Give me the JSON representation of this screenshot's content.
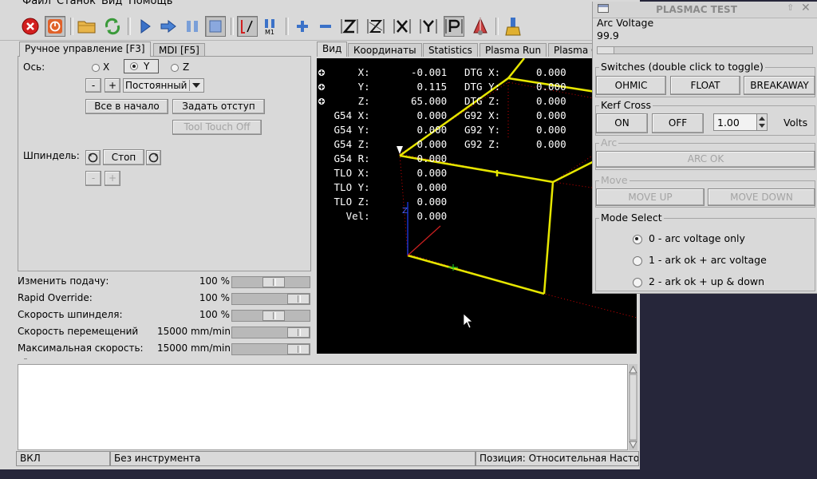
{
  "menu": {
    "items": [
      "Файл",
      "Станок",
      "Вид",
      "Помощь"
    ]
  },
  "toolbar": {
    "icons": [
      "estop-icon",
      "power-icon",
      "open-file-icon",
      "reload-icon",
      "run-icon",
      "step-icon",
      "pause-icon",
      "stop-icon",
      "block-delete-icon",
      "optional-stop-icon",
      "zoom-in-icon",
      "zoom-out-icon",
      "view-z-icon",
      "view-z2-icon",
      "view-x-icon",
      "view-y-icon",
      "view-p-icon",
      "rotate-view-icon",
      "clear-plot-icon"
    ]
  },
  "tabs_left": {
    "manual": "Ручное управление [F3]",
    "mdi": "MDI [F5]"
  },
  "manual": {
    "axis_label": "Ось:",
    "axes": [
      "X",
      "Y",
      "Z"
    ],
    "selected_axis": "Y",
    "jog_minus": "-",
    "jog_plus": "+",
    "jog_mode": "Постоянный",
    "home_all": "Все в начало",
    "touch_off": "Задать отступ",
    "tool_touch_off": "Tool Touch Off",
    "spindle_label": "Шпиндель:",
    "spindle_stop": "Стоп",
    "spindle_minus": "-",
    "spindle_plus": "+"
  },
  "overrides": [
    {
      "label": "Изменить подачу:",
      "value": "100 %",
      "fraction": 0.55
    },
    {
      "label": "Rapid Override:",
      "value": "100 %",
      "fraction": 1.0
    },
    {
      "label": "Скорость шпинделя:",
      "value": "100 %",
      "fraction": 0.55
    },
    {
      "label": "Скорость перемещений",
      "value": "15000 mm/min",
      "fraction": 1.0
    },
    {
      "label": "Максимальная скорость:",
      "value": "15000 mm/min",
      "fraction": 1.0
    }
  ],
  "tabs_right": [
    "Вид",
    "Координаты",
    "Statistics",
    "Plasma Run",
    "Plasma C"
  ],
  "dro": {
    "rows": [
      {
        "label": "     X:",
        "value": "-0.001",
        "label2": "DTG X:",
        "value2": "0.000"
      },
      {
        "label": "     Y:",
        "value": " 0.115",
        "label2": "DTG Y:",
        "value2": "0.000"
      },
      {
        "label": "     Z:",
        "value": "65.000",
        "label2": "DTG Z:",
        "value2": "0.000"
      },
      {
        "label": " G54 X:",
        "value": " 0.000",
        "label2": "G92 X:",
        "value2": "0.000"
      },
      {
        "label": " G54 Y:",
        "value": " 0.000",
        "label2": "G92 Y:",
        "value2": "0.000"
      },
      {
        "label": " G54 Z:",
        "value": " 0.000",
        "label2": "G92 Z:",
        "value2": "0.000"
      },
      {
        "label": " G54 R:",
        "value": " 0.000",
        "label2": "",
        "value2": ""
      },
      {
        "label": " TLO X:",
        "value": " 0.000",
        "label2": "",
        "value2": ""
      },
      {
        "label": " TLO Y:",
        "value": " 0.000",
        "label2": "",
        "value2": ""
      },
      {
        "label": " TLO Z:",
        "value": " 0.000",
        "label2": "",
        "value2": ""
      },
      {
        "label": "   Vel:",
        "value": " 0.000",
        "label2": "",
        "value2": ""
      }
    ]
  },
  "status": {
    "machine": "ВКЛ",
    "tool": "Без инструмента",
    "position": "Позиция: Относительная Настоящая"
  },
  "plasmac": {
    "title": "PLASMAC TEST",
    "arc_voltage_label": "Arc Voltage",
    "arc_voltage_value": "99.9",
    "switches_label": "Switches (double click to toggle)",
    "switches": [
      "OHMIC",
      "FLOAT",
      "BREAKAWAY"
    ],
    "kerf_label": "Kerf Cross",
    "kerf_on": "ON",
    "kerf_off": "OFF",
    "kerf_value": "1.00",
    "volts_label": "Volts",
    "arc_label": "Arc",
    "arc_ok": "ARC OK",
    "move_label": "Move",
    "move_up": "MOVE UP",
    "move_down": "MOVE DOWN",
    "mode_label": "Mode Select",
    "modes": [
      "0 - arc voltage only",
      "1 - ark ok + arc voltage",
      "2 - ark ok + up & down"
    ],
    "selected_mode": 0
  },
  "colors": {
    "background": "#d9d9d9",
    "preview_bg": "#000000",
    "toolpath": "#e6e600",
    "rapid": "#cc0000",
    "desktop": "#26263a"
  }
}
